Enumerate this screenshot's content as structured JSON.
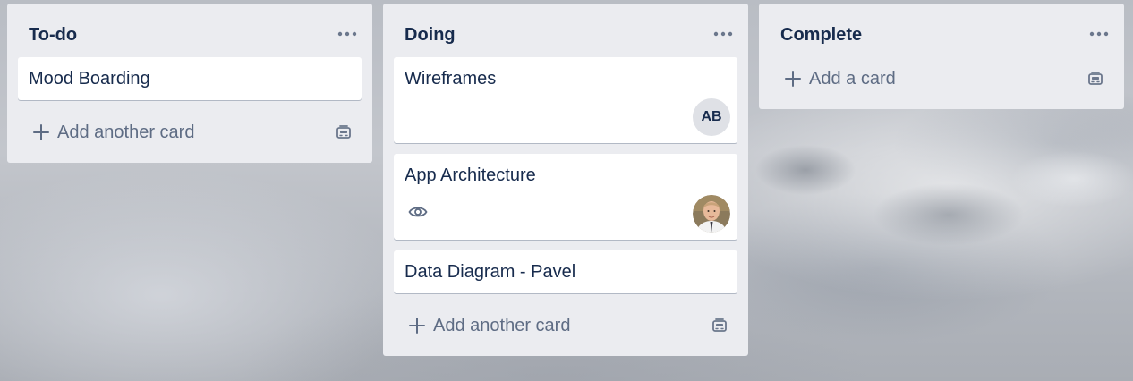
{
  "board": {
    "lists": [
      {
        "title": "To-do",
        "cards": [
          {
            "title": "Mood Boarding"
          }
        ],
        "add_label": "Add another card"
      },
      {
        "title": "Doing",
        "cards": [
          {
            "title": "Wireframes",
            "member_initials": "AB"
          },
          {
            "title": "App Architecture"
          },
          {
            "title": "Data Diagram - Pavel"
          }
        ],
        "add_label": "Add another card"
      },
      {
        "title": "Complete",
        "cards": [],
        "add_label": "Add a card"
      }
    ]
  },
  "colors": {
    "list_bg": "#ebecf0",
    "text_primary": "#172b4d",
    "text_subtle": "#5e6c84"
  }
}
